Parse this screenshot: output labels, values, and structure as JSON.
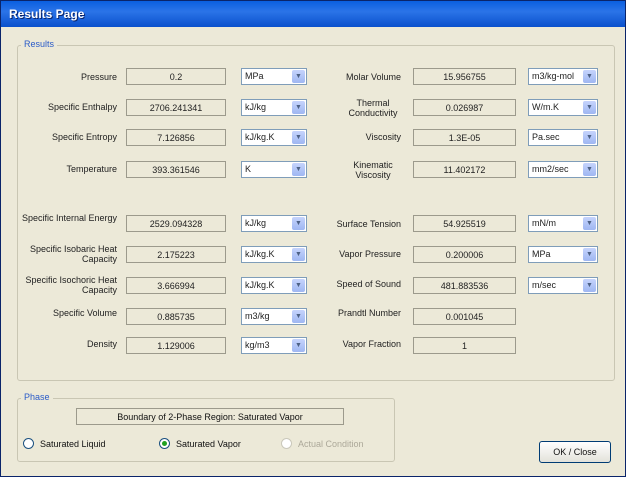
{
  "window": {
    "title": "Results Page"
  },
  "results": {
    "legend": "Results",
    "left": [
      {
        "label": "Pressure",
        "value": "0.2",
        "unit": "MPa"
      },
      {
        "label": "Specific Enthalpy",
        "value": "2706.241341",
        "unit": "kJ/kg"
      },
      {
        "label": "Specific Entropy",
        "value": "7.126856",
        "unit": "kJ/kg.K"
      },
      {
        "label": "Temperature",
        "value": "393.361546",
        "unit": "K"
      },
      {
        "label": "Specific Internal Energy",
        "value": "2529.094328",
        "unit": "kJ/kg"
      },
      {
        "label": "Specific Isobaric Heat Capacity",
        "value": "2.175223",
        "unit": "kJ/kg.K"
      },
      {
        "label": "Specific Isochoric Heat Capacity",
        "value": "3.666994",
        "unit": "kJ/kg.K"
      },
      {
        "label": "Specific Volume",
        "value": "0.885735",
        "unit": "m3/kg"
      },
      {
        "label": "Density",
        "value": "1.129006",
        "unit": "kg/m3"
      }
    ],
    "right": [
      {
        "label": "Molar Volume",
        "value": "15.956755",
        "unit": "m3/kg-mol"
      },
      {
        "label": "Thermal Conductivity",
        "value": "0.026987",
        "unit": "W/m.K"
      },
      {
        "label": "Viscosity",
        "value": "1.3E-05",
        "unit": "Pa.sec"
      },
      {
        "label": "Kinematic Viscosity",
        "value": "11.402172",
        "unit": "mm2/sec"
      },
      {
        "label": "Surface Tension",
        "value": "54.925519",
        "unit": "mN/m"
      },
      {
        "label": "Vapor Pressure",
        "value": "0.200006",
        "unit": "MPa"
      },
      {
        "label": "Speed of Sound",
        "value": "481.883536",
        "unit": "m/sec"
      },
      {
        "label": "Prandtl Number",
        "value": "0.001045"
      },
      {
        "label": "Vapor Fraction",
        "value": "1"
      }
    ]
  },
  "phase": {
    "legend": "Phase",
    "status": "Boundary of 2-Phase Region: Saturated Vapor",
    "options": {
      "saturated_liquid": "Saturated Liquid",
      "saturated_vapor": "Saturated Vapor",
      "actual_condition": "Actual Condition"
    },
    "selected": "Saturated Vapor"
  },
  "buttons": {
    "ok_close": "OK / Close"
  }
}
